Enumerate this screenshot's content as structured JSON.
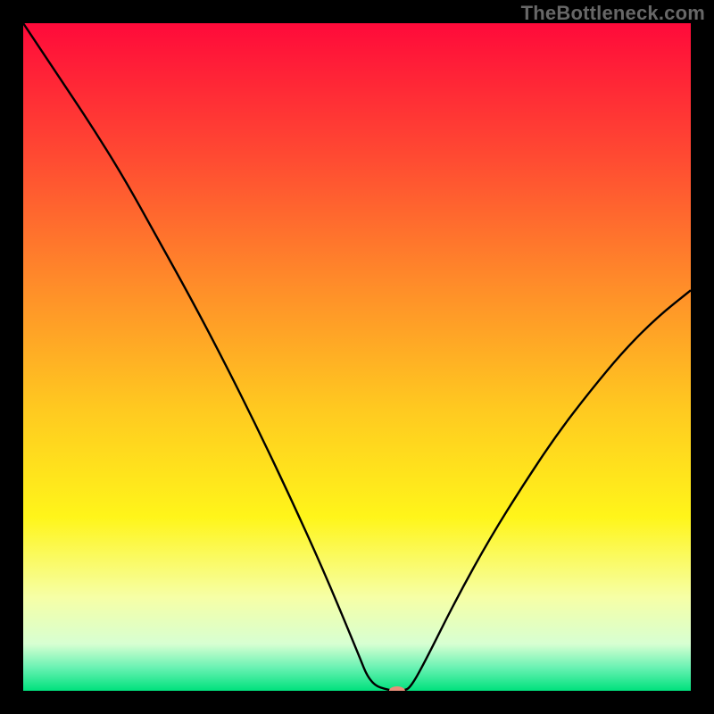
{
  "watermark": "TheBottleneck.com",
  "chart_data": {
    "type": "line",
    "title": "",
    "xlabel": "",
    "ylabel": "",
    "xlim": [
      0,
      100
    ],
    "ylim": [
      0,
      100
    ],
    "background_gradient": {
      "stops": [
        {
          "offset": 0,
          "color": "#ff0a3a"
        },
        {
          "offset": 0.2,
          "color": "#ff4a32"
        },
        {
          "offset": 0.4,
          "color": "#ff8f29"
        },
        {
          "offset": 0.58,
          "color": "#ffca20"
        },
        {
          "offset": 0.74,
          "color": "#fff51a"
        },
        {
          "offset": 0.86,
          "color": "#f6ffa6"
        },
        {
          "offset": 0.93,
          "color": "#d7ffd2"
        },
        {
          "offset": 0.965,
          "color": "#6af2b3"
        },
        {
          "offset": 1.0,
          "color": "#00e17d"
        }
      ]
    },
    "series": [
      {
        "name": "bottleneck-curve",
        "stroke": "#000000",
        "x": [
          0,
          5,
          10,
          15,
          20,
          25,
          30,
          35,
          40,
          45,
          50,
          52,
          55,
          57,
          58,
          60,
          65,
          70,
          75,
          80,
          85,
          90,
          95,
          100
        ],
        "values": [
          100,
          92.5,
          85,
          77,
          68,
          59,
          49.5,
          39.5,
          29,
          18,
          6,
          1,
          0,
          0,
          0.5,
          4,
          14,
          23,
          31,
          38.5,
          45,
          51,
          56,
          60
        ]
      }
    ],
    "marker": {
      "name": "optimal-point",
      "x": 56,
      "y": 0,
      "color": "#e98f7a",
      "rx": 9,
      "ry": 5
    }
  }
}
